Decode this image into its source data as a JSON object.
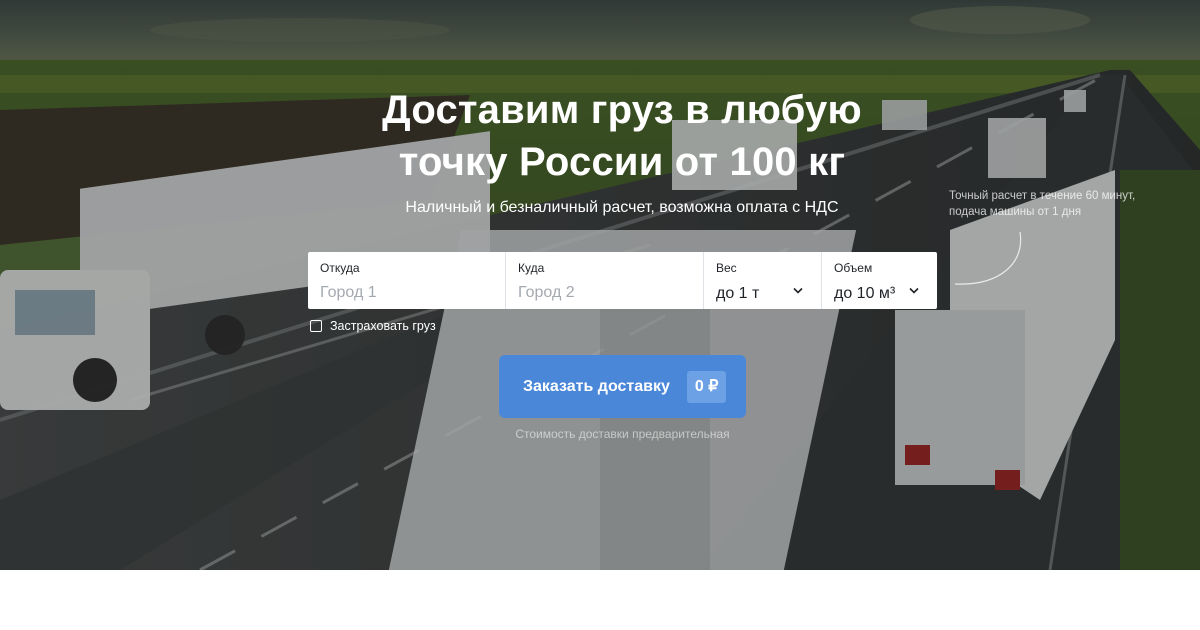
{
  "hero": {
    "title_line1": "Доставим груз в любую",
    "title_line2": "точку России от 100 кг",
    "subtitle": "Наличный и безналичный расчет, возможна оплата с НДС",
    "note": "Точный расчет в течение 60 минут, подача машины от 1 дня"
  },
  "form": {
    "from": {
      "label": "Откуда",
      "placeholder": "Город 1"
    },
    "to": {
      "label": "Куда",
      "placeholder": "Город 2"
    },
    "weight": {
      "label": "Вес",
      "value": "до 1 т"
    },
    "volume": {
      "label": "Объем",
      "value": "до 10 м³"
    },
    "insure_label": "Застраховать груз"
  },
  "order": {
    "button_label": "Заказать доставку",
    "price": "0 ₽",
    "hint": "Стоимость доставки предварительная"
  },
  "colors": {
    "accent": "#4a87d9",
    "price_badge": "#6da1e6"
  },
  "icons": [
    "chevron-down-icon",
    "checkbox-icon",
    "curved-arrow-icon"
  ]
}
